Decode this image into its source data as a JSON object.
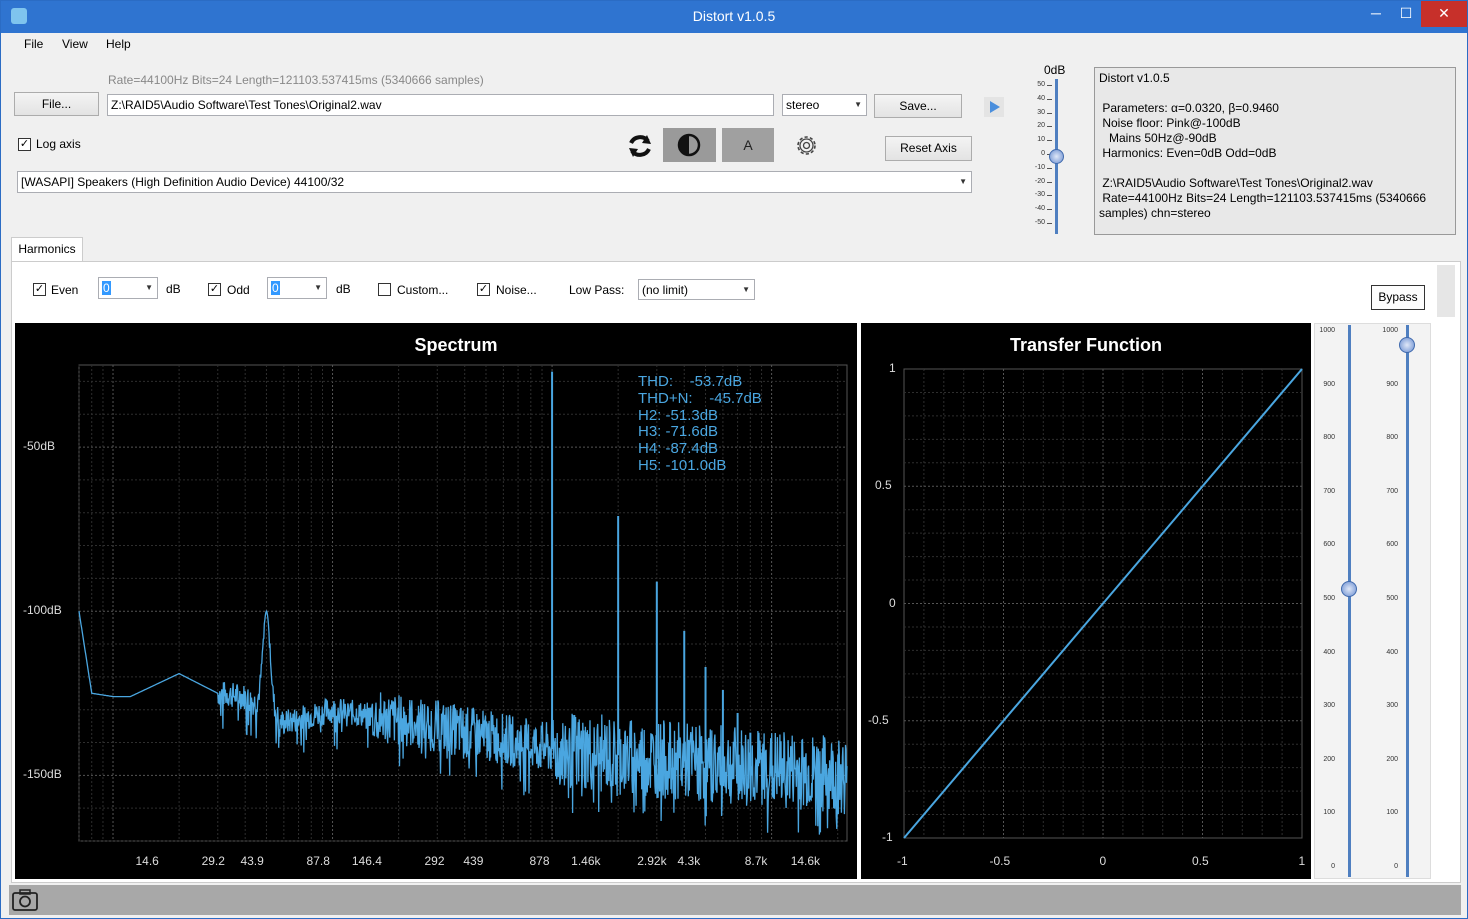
{
  "window": {
    "title": "Distort v1.0.5",
    "minimize": "─",
    "maximize": "☐",
    "close": "✕"
  },
  "menu": [
    "File",
    "View",
    "Help"
  ],
  "file": {
    "info": "Rate=44100Hz Bits=24 Length=121103.537415ms (5340666 samples)",
    "button": "File...",
    "path": "Z:\\RAID5\\Audio Software\\Test Tones\\Original2.wav",
    "channel": "stereo",
    "save": "Save..."
  },
  "log_axis": {
    "label": "Log axis",
    "checked": true
  },
  "toolbar": {
    "a_button": "A",
    "reset_axis": "Reset Axis"
  },
  "device": "[WASAPI] Speakers (High Definition Audio Device) 44100/32",
  "volume": {
    "label": "0dB",
    "ticks": [
      "50",
      "40",
      "30",
      "20",
      "10",
      "0",
      "-10",
      "-20",
      "-30",
      "-40",
      "-50"
    ],
    "value_db": 0
  },
  "info_panel": "Distort v1.0.5\n\n Parameters: α=0.0320, β=0.9460\n Noise floor: Pink@-100dB\n   Mains 50Hz@-90dB\n Harmonics: Even=0dB Odd=0dB\n\n Z:\\RAID5\\Audio Software\\Test Tones\\Original2.wav\n Rate=44100Hz Bits=24 Length=121103.537415ms (5340666\nsamples) chn=stereo",
  "tab": "Harmonics",
  "harmonics": {
    "even_label": "Even",
    "even_checked": true,
    "even_value": "0",
    "even_unit": "dB",
    "odd_label": "Odd",
    "odd_checked": true,
    "odd_value": "0",
    "odd_unit": "dB",
    "custom_label": "Custom...",
    "custom_checked": false,
    "noise_label": "Noise...",
    "noise_checked": true,
    "lowpass_label": "Low Pass:",
    "lowpass_value": "(no limit)",
    "bypass": "Bypass"
  },
  "spectrum": {
    "title": "Spectrum",
    "y_ticks": [
      "-50dB",
      "-100dB",
      "-150dB"
    ],
    "x_ticks": [
      "14.6",
      "29.2",
      "43.9",
      "87.8",
      "146.4",
      "292",
      "439",
      "878",
      "1.46k",
      "2.92k",
      "4.3k",
      "8.7k",
      "14.6k"
    ],
    "annotations": [
      "THD:    -53.7dB",
      "THD+N:    -45.7dB",
      "H2: -51.3dB",
      "H3: -71.6dB",
      "H4: -87.4dB",
      "H5: -101.0dB"
    ],
    "accent": "#4aa6e0"
  },
  "transfer": {
    "title": "Transfer Function",
    "y_ticks": [
      "1",
      "0.5",
      "0",
      "-0.5",
      "-1"
    ],
    "x_ticks": [
      "-1",
      "-0.5",
      "0",
      "0.5",
      "1"
    ]
  },
  "sliders": {
    "ticks": [
      "1000",
      "900",
      "800",
      "700",
      "600",
      "500",
      "400",
      "300",
      "200",
      "100",
      "0"
    ],
    "left_value": 520,
    "right_value": 975
  },
  "chart_data": [
    {
      "type": "line",
      "title": "Spectrum",
      "xlabel": "",
      "ylabel": "",
      "x_scale": "log",
      "ylim": [
        -170,
        -25
      ],
      "harmonic_peaks": [
        {
          "freq": 1000,
          "db": -27
        },
        {
          "freq": 2000,
          "db": -71
        },
        {
          "freq": 3000,
          "db": -91
        },
        {
          "freq": 4000,
          "db": -106
        },
        {
          "freq": 5000,
          "db": -117
        },
        {
          "freq": 6000,
          "db": -124
        },
        {
          "freq": 7000,
          "db": -131
        },
        {
          "freq": 8000,
          "db": -137
        }
      ],
      "mains_peak": {
        "freq": 50,
        "db": -100
      },
      "noise_floor": [
        [
          7,
          -100
        ],
        [
          8,
          -125
        ],
        [
          10,
          -126
        ],
        [
          12,
          -126
        ],
        [
          20,
          -119
        ],
        [
          30,
          -125
        ],
        [
          40,
          -126
        ],
        [
          60,
          -134
        ],
        [
          100,
          -130
        ],
        [
          300,
          -135
        ],
        [
          1000,
          -142
        ],
        [
          3000,
          -145
        ],
        [
          10000,
          -148
        ],
        [
          20000,
          -150
        ]
      ]
    },
    {
      "type": "line",
      "title": "Transfer Function",
      "xlim": [
        -1,
        1
      ],
      "ylim": [
        -1,
        1
      ],
      "series": [
        {
          "x": [
            -1,
            0,
            1
          ],
          "y": [
            -1,
            0,
            1
          ]
        }
      ]
    }
  ]
}
